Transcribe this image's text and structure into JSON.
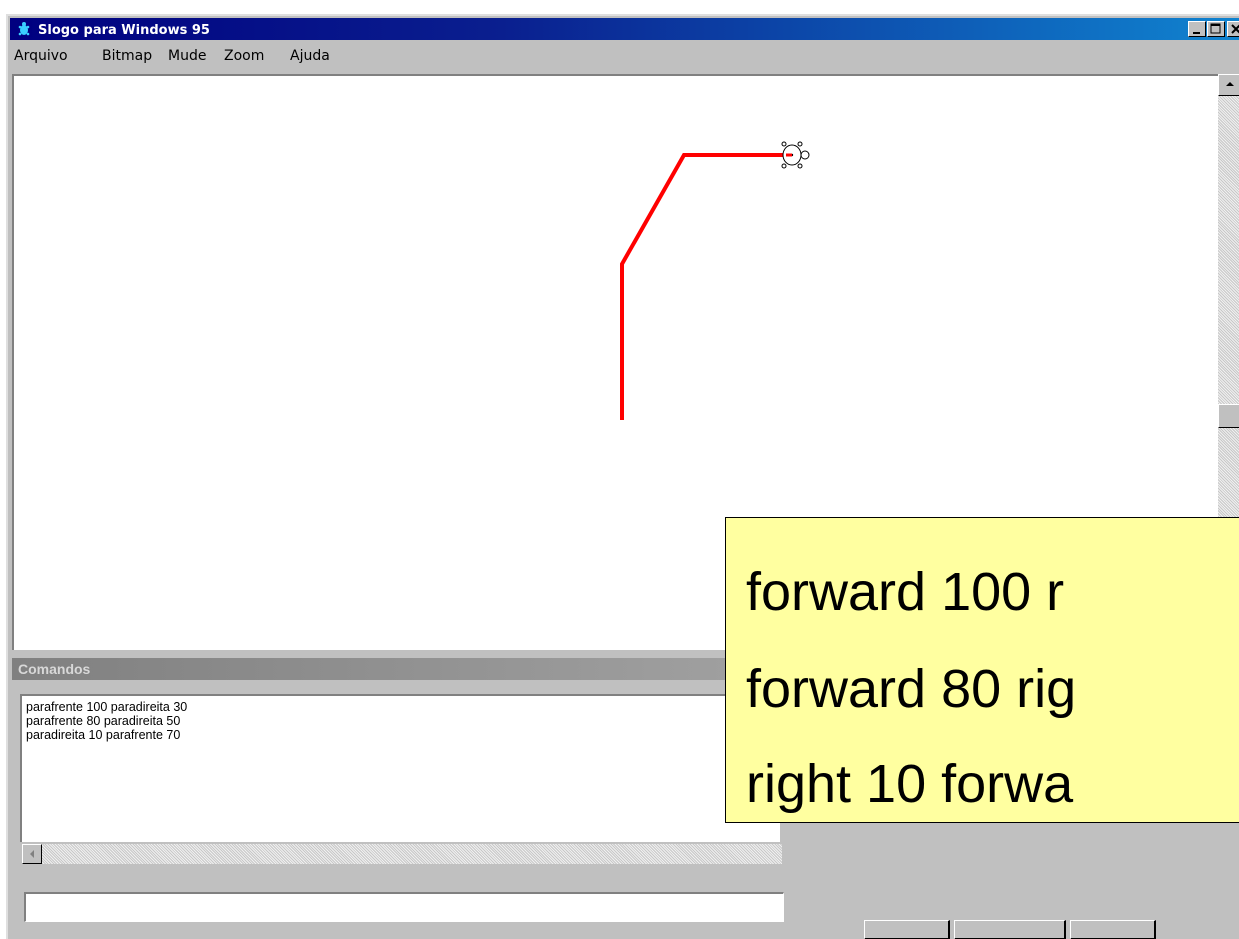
{
  "window": {
    "title": "Slogo para Windows 95",
    "app_icon": "turtle-icon",
    "controls": {
      "minimize": "minimize-icon",
      "maximize": "maximize-icon",
      "close": "close-icon"
    }
  },
  "menu": [
    {
      "label": "Arquivo"
    },
    {
      "label": "Bitmap"
    },
    {
      "label": "Mude"
    },
    {
      "label": "Zoom"
    },
    {
      "label": "Ajuda"
    }
  ],
  "canvas": {
    "pen_color": "#ff0000",
    "turtle_icon": "turtle-icon"
  },
  "commands_panel": {
    "title": "Comandos",
    "log": [
      "parafrente 100 paradireita 30",
      "parafrente 80 paradireita 50",
      "paradireita 10 parafrente 70"
    ],
    "input_value": ""
  },
  "overlay": {
    "background": "#ffffa0",
    "lines": [
      "forward 100 r",
      "forward 80 rig",
      "right 10 forwa"
    ]
  }
}
